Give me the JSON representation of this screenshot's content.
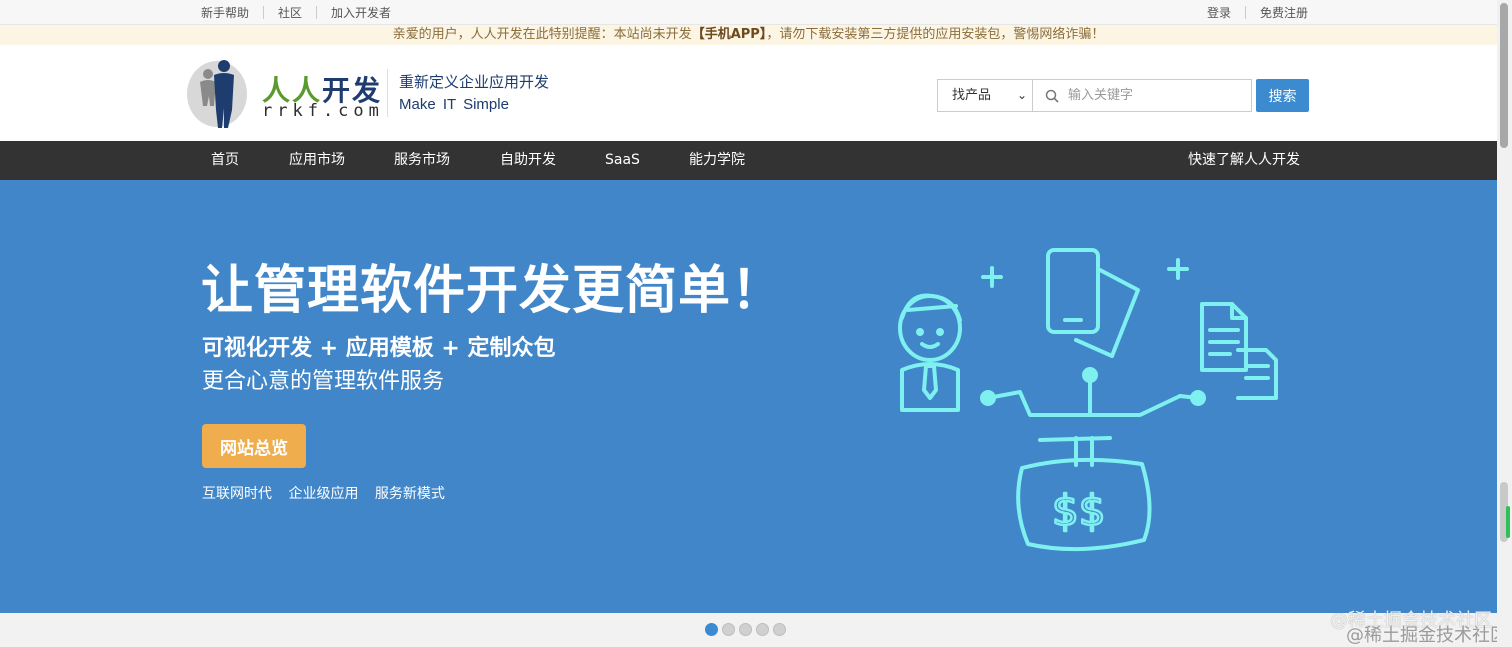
{
  "topbar": {
    "left_links": [
      "新手帮助",
      "社区",
      "加入开发者"
    ],
    "right_links": [
      "登录",
      "免费注册"
    ]
  },
  "notice": {
    "prefix": "亲爱的用户，人人开发在此特别提醒：本站尚未开发",
    "highlight": "【手机APP】",
    "suffix": "，请勿下载安装第三方提供的应用安装包，警惕网络诈骗！"
  },
  "brand": {
    "name_part1": "人人",
    "name_part2": "开发",
    "domain": "rrkf.com",
    "slogan_cn": "重新定义企业应用开发",
    "slogan_en": "Make IT Simple"
  },
  "search": {
    "category": "找产品",
    "placeholder": "输入关键字",
    "button": "搜索"
  },
  "nav": {
    "items": [
      "首页",
      "应用市场",
      "服务市场",
      "自助开发",
      "SaaS",
      "能力学院"
    ],
    "right": "快速了解人人开发"
  },
  "banner": {
    "title": "让管理软件开发更简单！",
    "subtitle1": "可视化开发 + 应用模板 + 定制众包",
    "subtitle2": "更合心意的管理软件服务",
    "cta": "网站总览",
    "tags": [
      "互联网时代",
      "企业级应用",
      "服务新模式"
    ]
  },
  "carousel": {
    "count": 5,
    "active": 0
  },
  "watermark": "@稀土掘金技术社区",
  "colors": {
    "primary": "#3c8ad0",
    "banner": "#4186c8",
    "nav": "#333333",
    "cta": "#f0ad4e",
    "illustration": "#7ff0f0"
  }
}
